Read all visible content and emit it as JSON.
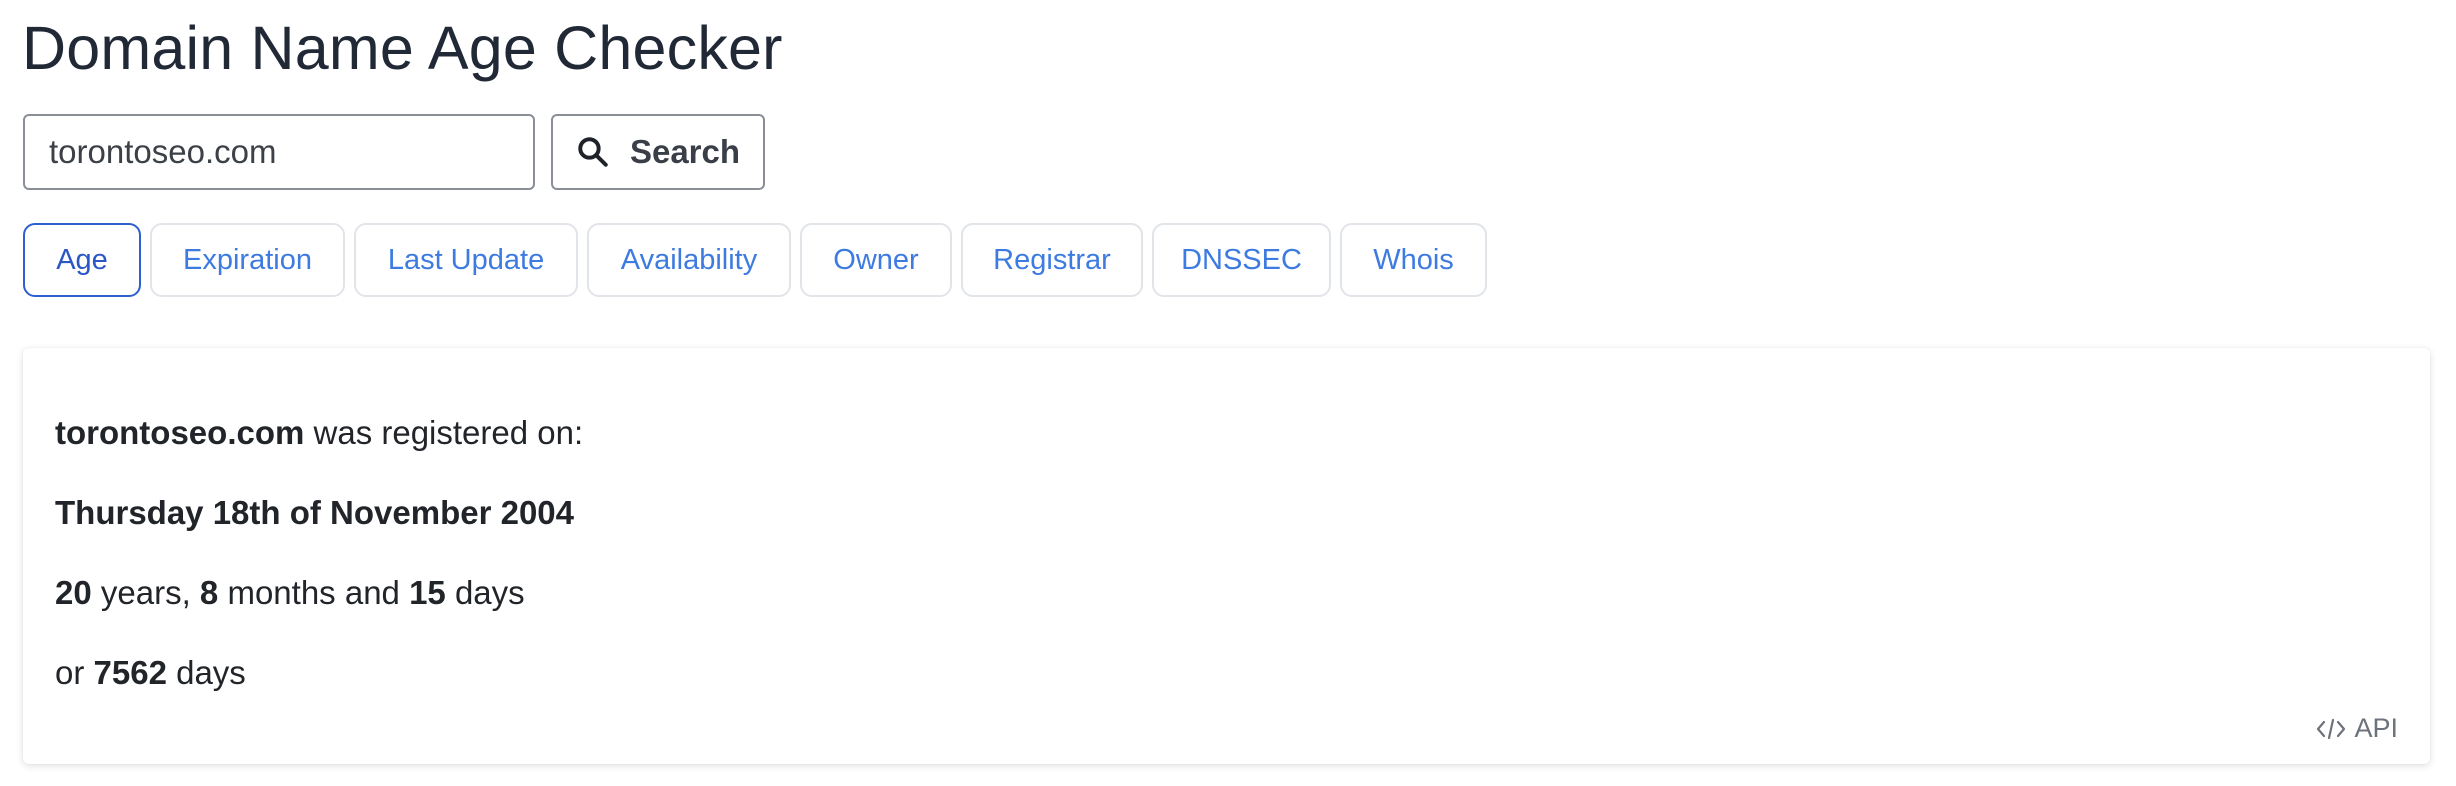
{
  "page": {
    "title": "Domain Name Age Checker"
  },
  "search": {
    "value": "torontoseo.com",
    "button_label": "Search",
    "icon": "search-icon"
  },
  "tabs": [
    {
      "label": "Age",
      "active": true
    },
    {
      "label": "Expiration",
      "active": false
    },
    {
      "label": "Last Update",
      "active": false
    },
    {
      "label": "Availability",
      "active": false
    },
    {
      "label": "Owner",
      "active": false
    },
    {
      "label": "Registrar",
      "active": false
    },
    {
      "label": "DNSSEC",
      "active": false
    },
    {
      "label": "Whois",
      "active": false
    }
  ],
  "result": {
    "domain": "torontoseo.com",
    "registered_text": " was registered on:",
    "date": "Thursday 18th of November 2004",
    "years": "20",
    "years_label": " years, ",
    "months": "8",
    "months_label": " months and ",
    "days": "15",
    "days_label": " days",
    "or_label": "or ",
    "total_days": "7562",
    "total_days_label": " days"
  },
  "api": {
    "label": "API",
    "icon": "code-icon"
  },
  "colors": {
    "tab_text": "#3d7be0",
    "tab_active_border": "#2e5fd0"
  }
}
